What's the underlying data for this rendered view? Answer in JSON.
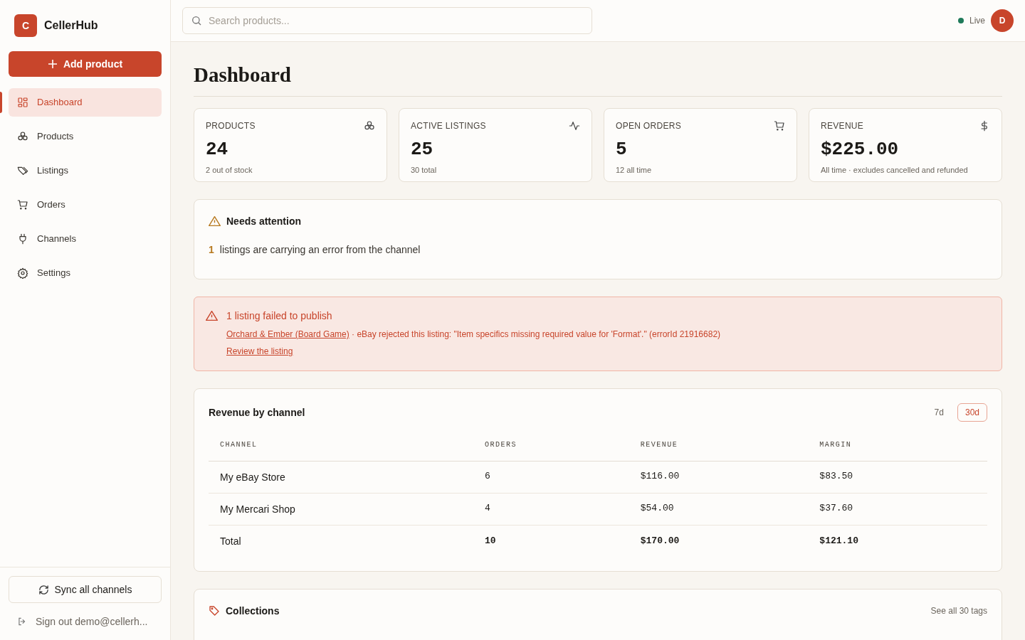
{
  "brand": {
    "logo_letter": "C",
    "name": "CellerHub"
  },
  "add_button": "Add product",
  "nav": [
    {
      "label": "Dashboard",
      "selected": true
    },
    {
      "label": "Products",
      "selected": false
    },
    {
      "label": "Listings",
      "selected": false
    },
    {
      "label": "Orders",
      "selected": false
    },
    {
      "label": "Channels",
      "selected": false
    },
    {
      "label": "Settings",
      "selected": false
    }
  ],
  "sync_button": "Sync all channels",
  "sign_out": "Sign out demo@cellerh...",
  "search": {
    "placeholder": "Search products..."
  },
  "status": {
    "label": "Live",
    "color": "#1f7a5a"
  },
  "avatar": "D",
  "page_title": "Dashboard",
  "stats": [
    {
      "label": "PRODUCTS",
      "value": "24",
      "note": "2 out of stock"
    },
    {
      "label": "ACTIVE LISTINGS",
      "value": "25",
      "note": "30 total"
    },
    {
      "label": "OPEN ORDERS",
      "value": "5",
      "note": "12 all time"
    },
    {
      "label": "REVENUE",
      "value": "$225.00",
      "note": "All time · excludes cancelled and refunded"
    }
  ],
  "attention": {
    "title": "Needs attention",
    "count": "1",
    "text": "listings are carrying an error from the channel"
  },
  "error": {
    "title": "1 listing failed to publish",
    "item_link": "Orchard & Ember (Board Game)",
    "message": "· eBay rejected this listing: \"Item specifics missing required value for 'Format'.\" (errorId 21916682)",
    "action_link": "Review the listing"
  },
  "revenue": {
    "title": "Revenue by channel",
    "ranges": [
      {
        "label": "7d",
        "selected": false
      },
      {
        "label": "30d",
        "selected": true
      }
    ],
    "columns": [
      "CHANNEL",
      "ORDERS",
      "REVENUE",
      "MARGIN"
    ],
    "rows": [
      {
        "channel": "My eBay Store",
        "orders": "6",
        "revenue": "$116.00",
        "margin": "$83.50",
        "total": false
      },
      {
        "channel": "My Mercari Shop",
        "orders": "4",
        "revenue": "$54.00",
        "margin": "$37.60",
        "total": false
      },
      {
        "channel": "Total",
        "orders": "10",
        "revenue": "$170.00",
        "margin": "$121.10",
        "total": true
      }
    ]
  },
  "collections": {
    "title": "Collections",
    "link": "See all 30 tags"
  }
}
